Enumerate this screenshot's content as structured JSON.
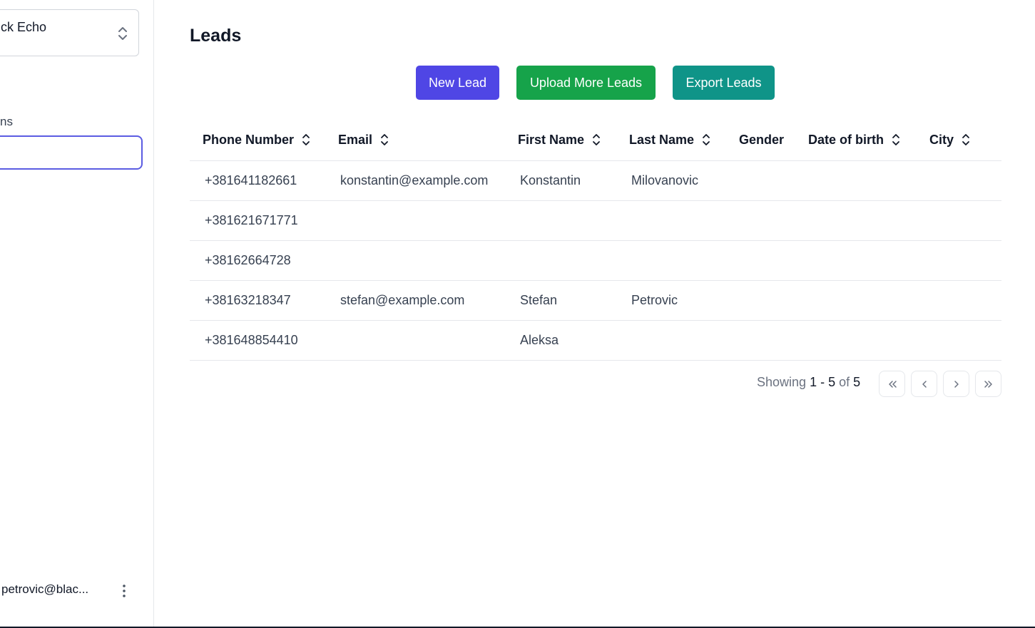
{
  "sidebar": {
    "org_name": "ck Echo",
    "section_label": "ns",
    "user_email": "petrovic@blac..."
  },
  "main": {
    "title": "Leads",
    "buttons": {
      "new_lead": "New Lead",
      "upload_more": "Upload More Leads",
      "export": "Export Leads"
    },
    "table": {
      "columns": [
        "Phone Number",
        "Email",
        "First Name",
        "Last Name",
        "Gender",
        "Date of birth",
        "City"
      ],
      "sortable": [
        true,
        true,
        true,
        true,
        false,
        true,
        true
      ],
      "rows": [
        [
          "+381641182661",
          "konstantin@example.com",
          "Konstantin",
          "Milovanovic",
          "",
          "",
          ""
        ],
        [
          "+381621671771",
          "",
          "",
          "",
          "",
          "",
          ""
        ],
        [
          "+38162664728",
          "",
          "",
          "",
          "",
          "",
          ""
        ],
        [
          "+38163218347",
          "stefan@example.com",
          "Stefan",
          "Petrovic",
          "",
          "",
          ""
        ],
        [
          "+381648854410",
          "",
          "Aleksa",
          "",
          "",
          "",
          ""
        ]
      ]
    },
    "pagination": {
      "prefix": "Showing",
      "range": "1 - 5",
      "of": "of",
      "total": "5"
    }
  },
  "colors": {
    "new_lead": "#4f46e5",
    "upload": "#16a34a",
    "export": "#0f9488",
    "active_outline": "#5b5ce2"
  },
  "icons": {
    "org_switcher": "chevrons-up-down-icon",
    "user_menu": "more-vertical-icon",
    "sort": "chevrons-up-down-icon",
    "first_page": "chevrons-left-icon",
    "prev_page": "chevron-left-icon",
    "next_page": "chevron-right-icon",
    "last_page": "chevrons-right-icon"
  }
}
